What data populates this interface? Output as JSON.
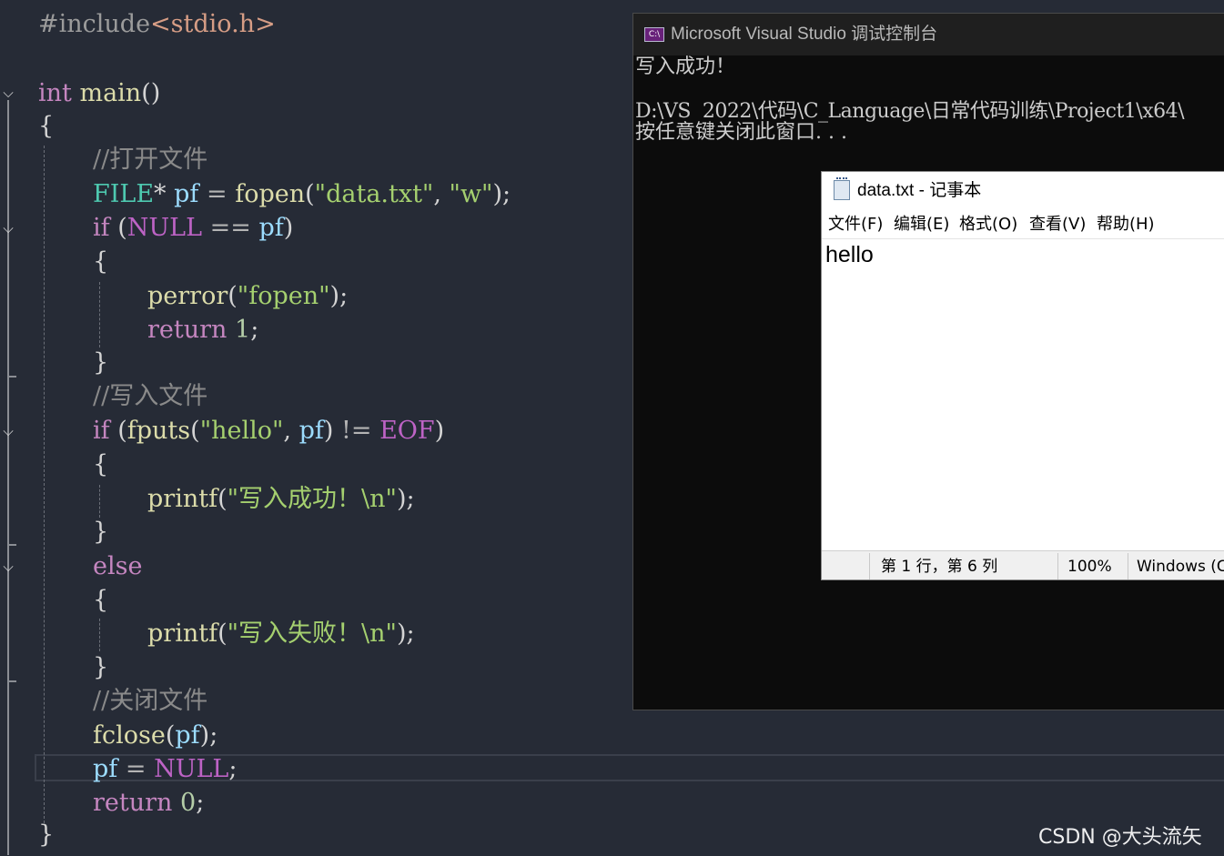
{
  "editor": {
    "lines": [
      {
        "id": "l1",
        "tokens": [
          [
            "pp",
            "#include"
          ],
          [
            "st",
            "<stdio.h>"
          ]
        ]
      },
      {
        "id": "l3",
        "tokens": [
          [
            "kw",
            "int"
          ],
          [
            "pl",
            " "
          ],
          [
            "fn",
            "main"
          ],
          [
            "pl",
            "()"
          ]
        ]
      },
      {
        "id": "l4",
        "tokens": [
          [
            "pl",
            "{"
          ]
        ]
      },
      {
        "id": "l5",
        "tokens": [
          [
            "cm",
            "//打开文件"
          ]
        ]
      },
      {
        "id": "l6",
        "tokens": [
          [
            "ty",
            "FILE"
          ],
          [
            "pl",
            "* "
          ],
          [
            "va",
            "pf"
          ],
          [
            "op",
            " = "
          ],
          [
            "fn",
            "fopen"
          ],
          [
            "pl",
            "("
          ],
          [
            "sg",
            "\"data.txt\""
          ],
          [
            "pl",
            ", "
          ],
          [
            "sg",
            "\"w\""
          ],
          [
            "pl",
            ");"
          ]
        ]
      },
      {
        "id": "l7",
        "tokens": [
          [
            "kw",
            "if"
          ],
          [
            "pl",
            " ("
          ],
          [
            "ma",
            "NULL"
          ],
          [
            "op",
            " == "
          ],
          [
            "va",
            "pf"
          ],
          [
            "pl",
            ")"
          ]
        ]
      },
      {
        "id": "l8",
        "tokens": [
          [
            "pl",
            "{"
          ]
        ]
      },
      {
        "id": "l9",
        "tokens": [
          [
            "fn",
            "perror"
          ],
          [
            "pl",
            "("
          ],
          [
            "sg",
            "\"fopen\""
          ],
          [
            "pl",
            ");"
          ]
        ]
      },
      {
        "id": "l10",
        "tokens": [
          [
            "kw",
            "return"
          ],
          [
            "pl",
            " "
          ],
          [
            "nu",
            "1"
          ],
          [
            "pl",
            ";"
          ]
        ]
      },
      {
        "id": "l11",
        "tokens": [
          [
            "pl",
            "}"
          ]
        ]
      },
      {
        "id": "l12",
        "tokens": [
          [
            "cm",
            "//写入文件"
          ]
        ]
      },
      {
        "id": "l13",
        "tokens": [
          [
            "kw",
            "if"
          ],
          [
            "pl",
            " ("
          ],
          [
            "fn",
            "fputs"
          ],
          [
            "pl",
            "("
          ],
          [
            "sg",
            "\"hello\""
          ],
          [
            "pl",
            ", "
          ],
          [
            "va",
            "pf"
          ],
          [
            "pl",
            ")"
          ],
          [
            "op",
            " != "
          ],
          [
            "ma",
            "EOF"
          ],
          [
            "pl",
            ")"
          ]
        ]
      },
      {
        "id": "l14",
        "tokens": [
          [
            "pl",
            "{"
          ]
        ]
      },
      {
        "id": "l15",
        "tokens": [
          [
            "fn",
            "printf"
          ],
          [
            "pl",
            "("
          ],
          [
            "sg",
            "\"写入成功！\\n\""
          ],
          [
            "pl",
            ");"
          ]
        ]
      },
      {
        "id": "l16",
        "tokens": [
          [
            "pl",
            "}"
          ]
        ]
      },
      {
        "id": "l17",
        "tokens": [
          [
            "kw",
            "else"
          ]
        ]
      },
      {
        "id": "l18",
        "tokens": [
          [
            "pl",
            "{"
          ]
        ]
      },
      {
        "id": "l19",
        "tokens": [
          [
            "fn",
            "printf"
          ],
          [
            "pl",
            "("
          ],
          [
            "sg",
            "\"写入失败！\\n\""
          ],
          [
            "pl",
            ");"
          ]
        ]
      },
      {
        "id": "l20",
        "tokens": [
          [
            "pl",
            "}"
          ]
        ]
      },
      {
        "id": "l21",
        "tokens": [
          [
            "cm",
            "//关闭文件"
          ]
        ]
      },
      {
        "id": "l22",
        "tokens": [
          [
            "fn",
            "fclose"
          ],
          [
            "pl",
            "("
          ],
          [
            "va",
            "pf"
          ],
          [
            "pl",
            ");"
          ]
        ]
      },
      {
        "id": "l23",
        "tokens": [
          [
            "va",
            "pf"
          ],
          [
            "op",
            " = "
          ],
          [
            "ma",
            "NULL"
          ],
          [
            "pl",
            ";"
          ]
        ]
      },
      {
        "id": "l24",
        "tokens": [
          [
            "kw",
            "return"
          ],
          [
            "pl",
            " "
          ],
          [
            "nu",
            "0"
          ],
          [
            "pl",
            ";"
          ]
        ]
      },
      {
        "id": "l25",
        "tokens": [
          [
            "pl",
            "}"
          ]
        ]
      }
    ],
    "fold_icons": [
      "chevron-down-icon",
      "chevron-down-icon",
      "chevron-down-icon",
      "chevron-down-icon"
    ],
    "colors": {
      "background": "#262b36",
      "keyword": "#c586c0",
      "type": "#4ec9b0",
      "function": "#dcdcaa",
      "variable": "#9cdcfe",
      "string": "#a5d06f",
      "comment": "#8a8a8a",
      "macro": "#bd63c5"
    }
  },
  "console": {
    "icon": "console-app-icon",
    "title": "Microsoft Visual Studio 调试控制台",
    "lines": [
      "写入成功！",
      "",
      "D:\\VS  2022\\代码\\C_Language\\日常代码训练\\Project1\\x64\\",
      "按任意键关闭此窗口. . ."
    ]
  },
  "notepad": {
    "icon": "notepad-icon",
    "title": "data.txt - 记事本",
    "menu": [
      "文件(F)",
      "编辑(E)",
      "格式(O)",
      "查看(V)",
      "帮助(H)"
    ],
    "content": "hello",
    "status": {
      "position": "第 1 行，第 6 列",
      "zoom": "100%",
      "encoding": "Windows (C"
    }
  },
  "watermark": "CSDN @大头流矢"
}
